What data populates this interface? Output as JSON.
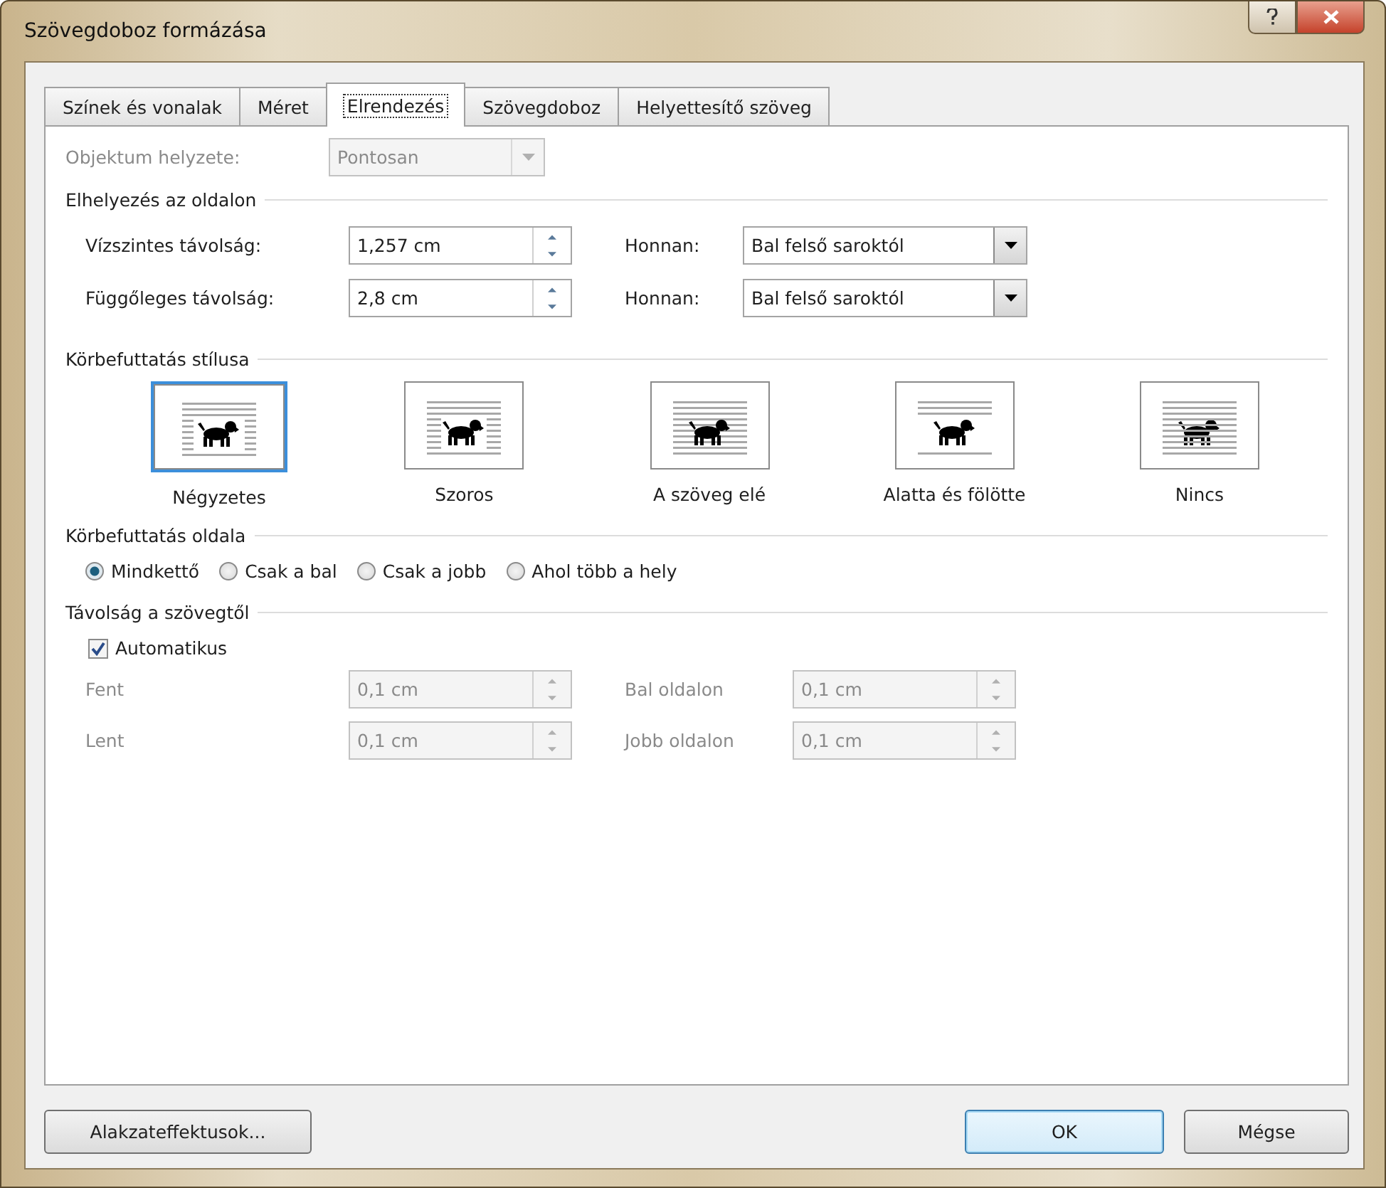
{
  "window": {
    "title": "Szövegdoboz formázása"
  },
  "tabs": [
    {
      "label": "Színek és vonalak",
      "selected": false
    },
    {
      "label": "Méret",
      "selected": false
    },
    {
      "label": "Elrendezés",
      "selected": true
    },
    {
      "label": "Szövegdoboz",
      "selected": false
    },
    {
      "label": "Helyettesítő szöveg",
      "selected": false
    }
  ],
  "object_position": {
    "label": "Objektum helyzete:",
    "value": "Pontosan",
    "disabled": true
  },
  "placement": {
    "heading": "Elhelyezés az oldalon",
    "rows": [
      {
        "label": "Vízszintes távolság:",
        "value": "1,257 cm",
        "from_label": "Honnan:",
        "from_value": "Bal felső saroktól"
      },
      {
        "label": "Függőleges távolság:",
        "value": "2,8 cm",
        "from_label": "Honnan:",
        "from_value": "Bal felső saroktól"
      }
    ]
  },
  "wrap_style": {
    "heading": "Körbefuttatás stílusa",
    "options": [
      {
        "label": "Négyzetes",
        "kind": "square",
        "selected": true
      },
      {
        "label": "Szoros",
        "kind": "tight",
        "selected": false
      },
      {
        "label": "A szöveg elé",
        "kind": "front",
        "selected": false
      },
      {
        "label": "Alatta és fölötte",
        "kind": "topbottom",
        "selected": false
      },
      {
        "label": "Nincs",
        "kind": "none",
        "selected": false
      }
    ]
  },
  "wrap_side": {
    "heading": "Körbefuttatás oldala",
    "options": [
      {
        "label": "Mindkettő",
        "selected": true
      },
      {
        "label": "Csak a bal",
        "selected": false
      },
      {
        "label": "Csak a jobb",
        "selected": false
      },
      {
        "label": "Ahol több a hely",
        "selected": false
      }
    ]
  },
  "distance": {
    "heading": "Távolság a szövegtől",
    "auto": {
      "label": "Automatikus",
      "checked": true
    },
    "rows": [
      [
        {
          "label": "Fent",
          "value": "0,1 cm",
          "disabled": true
        },
        {
          "label": "Bal oldalon",
          "value": "0,1 cm",
          "disabled": true
        }
      ],
      [
        {
          "label": "Lent",
          "value": "0,1 cm",
          "disabled": true
        },
        {
          "label": "Jobb oldalon",
          "value": "0,1 cm",
          "disabled": true
        }
      ]
    ]
  },
  "buttons": [
    {
      "label": "Alakzateffektusok...",
      "default": false
    },
    {
      "label": "OK",
      "default": true
    },
    {
      "label": "Mégse",
      "default": false
    }
  ]
}
